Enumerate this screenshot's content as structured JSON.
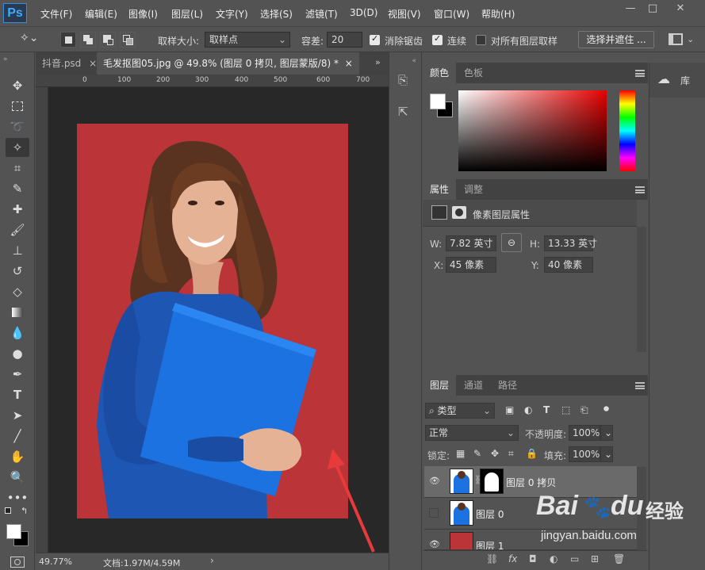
{
  "app": {
    "logo": "Ps"
  },
  "menu": [
    "文件(F)",
    "编辑(E)",
    "图像(I)",
    "图层(L)",
    "文字(Y)",
    "选择(S)",
    "滤镜(T)",
    "3D(D)",
    "视图(V)",
    "窗口(W)",
    "帮助(H)"
  ],
  "window_buttons": [
    "—",
    "□",
    "✕"
  ],
  "options": {
    "sample_size_label": "取样大小:",
    "sample_size_value": "取样点",
    "tolerance_label": "容差:",
    "tolerance_value": "20",
    "antialias_label": "消除锯齿",
    "contiguous_label": "连续",
    "all_layers_label": "对所有图层取样",
    "select_mask_label": "选择并遮住 ..."
  },
  "tabs": [
    {
      "label": "抖音.psd",
      "close": "×"
    },
    {
      "label": "毛发抠图05.jpg @ 49.8% (图层 0 拷贝, 图层蒙版/8) *",
      "close": "×"
    }
  ],
  "ruler_h": [
    "0",
    "100",
    "200",
    "300",
    "400",
    "500",
    "600",
    "700"
  ],
  "status": {
    "zoom": "49.77%",
    "doc": "文档:1.97M/4.59M",
    "arrow": "›"
  },
  "color_panel": {
    "tabs": [
      "颜色",
      "色板"
    ]
  },
  "properties_panel": {
    "tabs": [
      "属性",
      "调整"
    ],
    "title": "像素图层属性",
    "w_label": "W:",
    "w_value": "7.82 英寸",
    "h_label": "H:",
    "h_value": "13.33 英寸",
    "x_label": "X:",
    "x_value": "45 像素",
    "y_label": "Y:",
    "y_value": "40 像素"
  },
  "library": {
    "label": "库"
  },
  "layers_panel": {
    "tabs": [
      "图层",
      "通道",
      "路径"
    ],
    "filter_label": "类型",
    "blend_mode": "正常",
    "opacity_label": "不透明度:",
    "opacity_value": "100%",
    "lock_label": "锁定:",
    "fill_label": "填充:",
    "fill_value": "100%",
    "layers": [
      {
        "name": "图层 0 拷贝",
        "visible": true,
        "selected": true
      },
      {
        "name": "图层 0",
        "visible": false,
        "selected": false
      },
      {
        "name": "图层 1",
        "visible": true,
        "selected": false
      }
    ],
    "bottom_icons": [
      "link-icon",
      "fx-icon",
      "mask-icon",
      "adjustment-icon",
      "folder-icon",
      "new-layer-icon",
      "trash-icon"
    ],
    "fx_label": "fx"
  },
  "watermark": {
    "brand": "Bai",
    "brand2": "du",
    "suffix": "经验",
    "url": "jingyan.baidu.com"
  },
  "colors": {
    "canvas_red": "#bb3437",
    "folder_blue": "#1c72e0",
    "shirt_blue": "#1e56b4",
    "arrow_red": "#e83a3a"
  }
}
